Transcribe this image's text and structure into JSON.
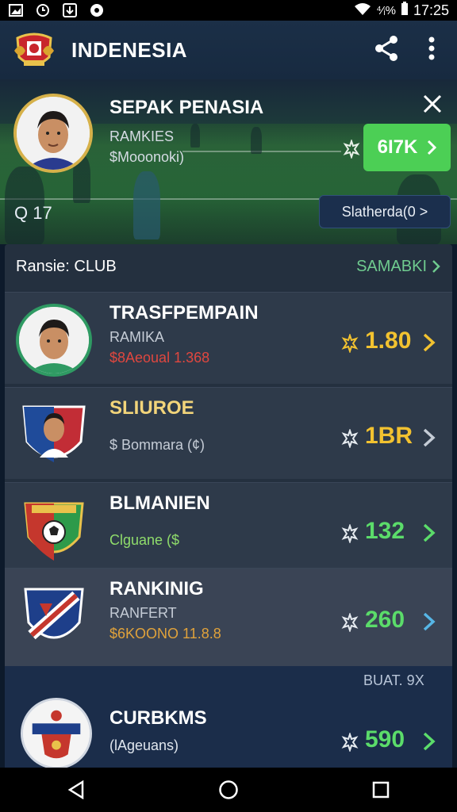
{
  "status_bar": {
    "time": "17:25",
    "signal_text": "⁴⁄ᵢ%"
  },
  "app_bar": {
    "title": "INDENESIA"
  },
  "hero": {
    "title": "SEPAK PENASIA",
    "subtitle1": "RAMKIES",
    "subtitle2": "$Mooonoki)",
    "score": "6I7K",
    "q_label": "Q 17",
    "stand_button": "Slatherda(0 >"
  },
  "panel": {
    "header_label": "Ransie: CLUB",
    "header_link": "SAMABKI"
  },
  "rows": [
    {
      "title": "TRASFPEMPAIN",
      "sub1": "RAMIKA",
      "sub2": "$8Aeoual 1.368",
      "sub2_color": "#e0473f",
      "value": "1.80",
      "value_color": "#f2c230",
      "chevron_color": "#f2c230"
    },
    {
      "title": "SLIUROE",
      "title_color": "#f2d47a",
      "sub1": "",
      "sub2": "$ Bommara (¢)",
      "sub2_color": "#c5ccd6",
      "value": "1BR",
      "value_color": "#f2c230",
      "chevron_color": "#c5ccd6"
    },
    {
      "title": "BLMANIEN",
      "sub1": "",
      "sub2": "Clguane ($",
      "sub2_color": "#8fdc6b",
      "value": "132",
      "value_color": "#5bdc6a",
      "chevron_color": "#5bdc6a"
    },
    {
      "title": "RANKINIG",
      "sub1": "RANFERT",
      "sub2": "$6KOONO 11.8.8",
      "sub2_color": "#e0a23b",
      "value": "260",
      "value_color": "#5bdc6a",
      "chevron_color": "#56b6e6"
    }
  ],
  "last_row": {
    "tag": "BUAT. 9X",
    "title": "CURBKMS",
    "sub": "(lAgeuans)",
    "value": "590",
    "value_color": "#5bdc6a"
  }
}
